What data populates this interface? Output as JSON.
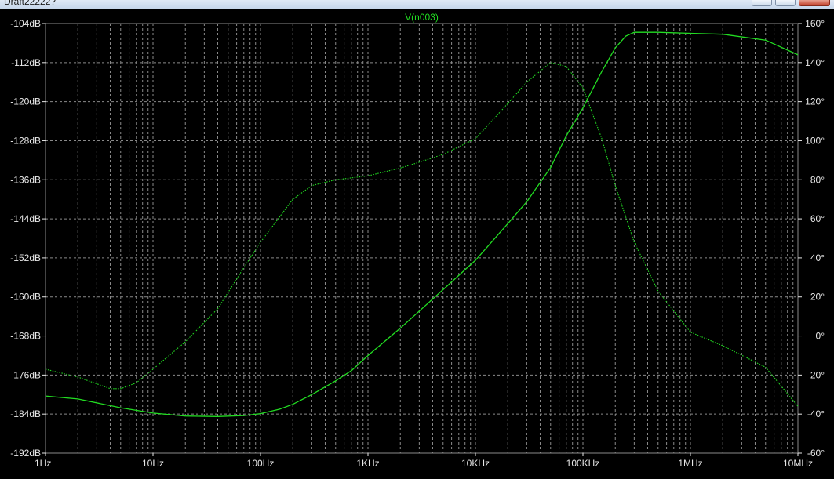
{
  "window": {
    "title": "Draft22222?",
    "minimize_icon": "minimize-icon",
    "maximize_icon": "maximize-icon",
    "close_icon": "close-icon"
  },
  "colors": {
    "background": "#000000",
    "grid": "#8a8a8a",
    "axis_text": "#e8e8e8",
    "trace": "#22dd22",
    "title_text": "#22dd22"
  },
  "chart_data": {
    "type": "line",
    "title": "V(n003)",
    "x_scale": "log",
    "xlim": [
      1,
      10000000
    ],
    "x_ticks": [
      {
        "value": 1,
        "label": "1Hz"
      },
      {
        "value": 10,
        "label": "10Hz"
      },
      {
        "value": 100,
        "label": "100Hz"
      },
      {
        "value": 1000,
        "label": "1KHz"
      },
      {
        "value": 10000,
        "label": "10KHz"
      },
      {
        "value": 100000,
        "label": "100KHz"
      },
      {
        "value": 1000000,
        "label": "1MHz"
      },
      {
        "value": 10000000,
        "label": "10MHz"
      }
    ],
    "y_left": {
      "unit": "dB",
      "ylim": [
        -192,
        -104
      ],
      "ticks": [
        {
          "value": -104,
          "label": "-104dB"
        },
        {
          "value": -112,
          "label": "-112dB"
        },
        {
          "value": -120,
          "label": "-120dB"
        },
        {
          "value": -128,
          "label": "-128dB"
        },
        {
          "value": -136,
          "label": "-136dB"
        },
        {
          "value": -144,
          "label": "-144dB"
        },
        {
          "value": -152,
          "label": "-152dB"
        },
        {
          "value": -160,
          "label": "-160dB"
        },
        {
          "value": -168,
          "label": "-168dB"
        },
        {
          "value": -176,
          "label": "-176dB"
        },
        {
          "value": -184,
          "label": "-184dB"
        },
        {
          "value": -192,
          "label": "-192dB"
        }
      ]
    },
    "y_right": {
      "unit": "degrees",
      "ylim": [
        -60,
        160
      ],
      "ticks": [
        {
          "value": 160,
          "label": "160°"
        },
        {
          "value": 140,
          "label": "140°"
        },
        {
          "value": 120,
          "label": "120°"
        },
        {
          "value": 100,
          "label": "100°"
        },
        {
          "value": 80,
          "label": "80°"
        },
        {
          "value": 60,
          "label": "60°"
        },
        {
          "value": 40,
          "label": "40°"
        },
        {
          "value": 20,
          "label": "20°"
        },
        {
          "value": 0,
          "label": "0°"
        },
        {
          "value": -20,
          "label": "-20°"
        },
        {
          "value": -40,
          "label": "-40°"
        },
        {
          "value": -60,
          "label": "-60°"
        }
      ]
    },
    "grid": true,
    "series": [
      {
        "axis": "left",
        "style": "solid",
        "x": [
          1,
          2,
          5,
          10,
          20,
          40,
          70,
          100,
          150,
          200,
          300,
          500,
          700,
          1000,
          2000,
          3000,
          5000,
          10000,
          20000,
          30000,
          50000,
          70000,
          100000,
          150000,
          200000,
          250000,
          300000,
          500000,
          1000000,
          2000000,
          5000000,
          10000000
        ],
        "y": [
          -180.3,
          -180.9,
          -182.7,
          -183.8,
          -184.4,
          -184.5,
          -184.3,
          -183.9,
          -183.0,
          -182.0,
          -180.0,
          -177.2,
          -175.1,
          -172.0,
          -166.4,
          -162.9,
          -158.5,
          -152.5,
          -145.0,
          -140.5,
          -133.5,
          -127.0,
          -121.3,
          -113.8,
          -109.0,
          -106.6,
          -105.8,
          -105.8,
          -106.0,
          -106.2,
          -107.4,
          -110.4
        ]
      },
      {
        "axis": "right",
        "style": "dotted",
        "x": [
          1,
          2,
          4,
          5,
          7,
          10,
          20,
          40,
          70,
          100,
          200,
          300,
          500,
          1000,
          2000,
          3000,
          5000,
          10000,
          20000,
          30000,
          50000,
          70000,
          100000,
          150000,
          200000,
          300000,
          500000,
          1000000,
          2000000,
          5000000,
          10000000
        ],
        "y": [
          -17,
          -21,
          -27,
          -27,
          -24,
          -17,
          -3,
          14,
          35,
          48,
          70,
          77,
          80,
          82,
          86,
          89,
          93,
          101,
          119,
          130,
          140,
          138,
          127,
          101,
          77,
          48,
          23,
          2,
          -5,
          -16,
          -36
        ]
      }
    ]
  }
}
